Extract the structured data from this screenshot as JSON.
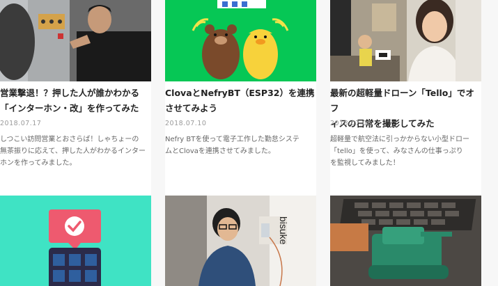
{
  "articles": [
    {
      "title": "営業撃退！？押した人が誰かわかる\n「インターホン・改」を作ってみた",
      "date": "2018.07.17",
      "excerpt": "しつこい訪問営業とおさらば！しゃちょーの\n無茶振りに応えて、押した人がわかるインター\nホンを作ってみました。"
    },
    {
      "title": "ClovaとNefryBT（ESP32）を連携\nさせてみよう",
      "date": "2018.07.10",
      "excerpt": "Nefry BTを使って電子工作した勤怠システ\nムとClovaを連携させてみました。"
    },
    {
      "title": "最新の超軽量ドローン「Tello」でオフ\nィスの日常を撮影してみた",
      "date": "2018.07.06",
      "excerpt": "超軽量で航空法に引っかからない小型ドロー\n「tello」を使って、みなさんの仕事っぷり\nを監視してみました！"
    }
  ],
  "second_row": [
    {
      "thumb": "phone-check-illustration"
    },
    {
      "thumb": "person-with-device-photo",
      "sign_text": "bisuke"
    },
    {
      "thumb": "3d-printed-tank-on-laptop-photo"
    }
  ],
  "colors": {
    "green_bg": "#06c755",
    "teal_bg": "#3fe3c4",
    "pink_sign": "#ee5a6f",
    "background": "#f7f7f7"
  }
}
